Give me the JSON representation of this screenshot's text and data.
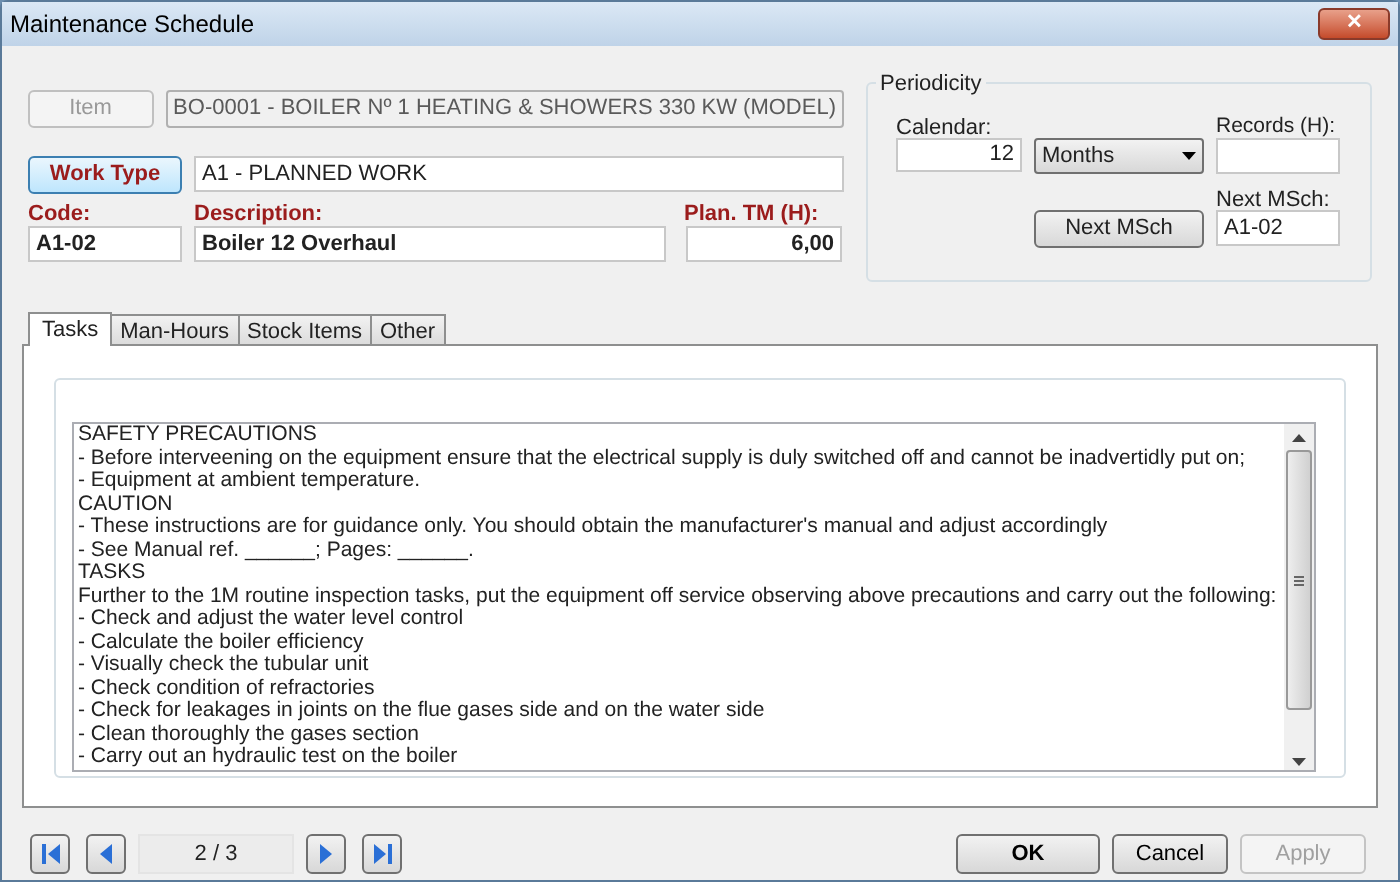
{
  "window": {
    "title": "Maintenance Schedule",
    "close": "✕"
  },
  "item": {
    "button": "Item",
    "button_disabled": true,
    "value": "BO-0001 - BOILER Nº 1 HEATING & SHOWERS 330 KW (MODEL)"
  },
  "work_type": {
    "button": "Work Type",
    "value": "A1 - PLANNED WORK"
  },
  "code": {
    "label": "Code:",
    "value": "A1-02"
  },
  "description": {
    "label": "Description:",
    "value": "Boiler 12 Overhaul"
  },
  "plan_tm": {
    "label": "Plan. TM (H):",
    "value": "6,00"
  },
  "periodicity": {
    "title": "Periodicity",
    "calendar_label": "Calendar:",
    "calendar_value": "12",
    "unit": "Months",
    "records_label": "Records (H):",
    "next_label": "Next MSch:",
    "next_value": "A1-02",
    "next_button": "Next MSch"
  },
  "tabs": [
    {
      "label": "Tasks",
      "selected": true
    },
    {
      "label": "Man-Hours",
      "selected": false
    },
    {
      "label": "Stock Items",
      "selected": false
    },
    {
      "label": "Other",
      "selected": false
    }
  ],
  "tasks_text": [
    "SAFETY PRECAUTIONS",
    "- Before interveening on the equipment ensure that the electrical supply is duly switched off and cannot be inadvertidly put on;",
    "- Equipment at ambient temperature.",
    "CAUTION",
    "- These instructions are for guidance only. You should obtain the manufacturer's manual and adjust accordingly",
    "- See Manual ref. ______; Pages: ______.",
    "TASKS",
    "Further to the 1M routine inspection tasks, put the equipment off service observing above precautions and carry out the following:",
    "- Check and adjust the water level control",
    "- Calculate the boiler efficiency",
    "- Visually check the tubular unit",
    "- Check condition of refractories",
    "- Check for leakages in joints on the flue gases side and on the water side",
    "- Clean thoroughly the gases section",
    "- Carry out an hydraulic test on the boiler"
  ],
  "navigator": {
    "position": "2 / 3"
  },
  "buttons": [
    {
      "label": "OK",
      "kind": "default",
      "disabled": false
    },
    {
      "label": "Cancel",
      "kind": "normal",
      "disabled": false
    },
    {
      "label": "Apply",
      "kind": "normal",
      "disabled": true
    }
  ]
}
